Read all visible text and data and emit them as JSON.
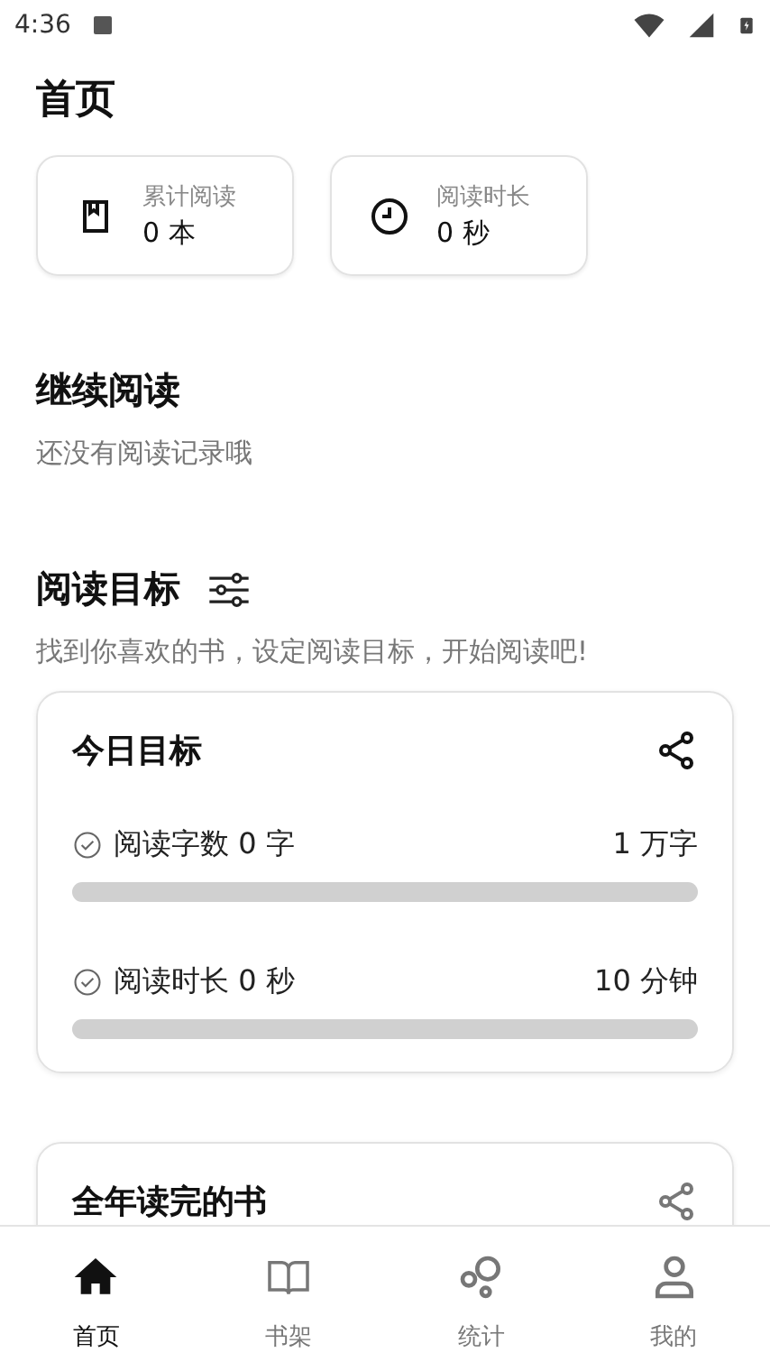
{
  "status_bar": {
    "time": "4:36"
  },
  "title": "首页",
  "stats": [
    {
      "kind": "book",
      "label": "累计阅读",
      "value": "0 本"
    },
    {
      "kind": "clock",
      "label": "阅读时长",
      "value": "0 秒"
    }
  ],
  "continue_reading": {
    "title": "继续阅读",
    "empty_text": "还没有阅读记录哦"
  },
  "goals": {
    "title": "阅读目标",
    "subtitle": "找到你喜欢的书，设定阅读目标，开始阅读吧!",
    "today": {
      "title": "今日目标",
      "items": [
        {
          "label": "阅读字数 0 字",
          "target": "1 万字",
          "level": 0
        },
        {
          "label": "阅读时长 0 秒",
          "target": "10 分钟",
          "level": 0
        }
      ]
    },
    "year": {
      "title": "全年读完的书"
    }
  },
  "nav": [
    {
      "kind": "home",
      "label": "首页",
      "selected": true
    },
    {
      "kind": "shelf",
      "label": "书架",
      "selected": false
    },
    {
      "kind": "stats",
      "label": "统计",
      "selected": false
    },
    {
      "kind": "me",
      "label": "我的",
      "selected": false
    }
  ]
}
